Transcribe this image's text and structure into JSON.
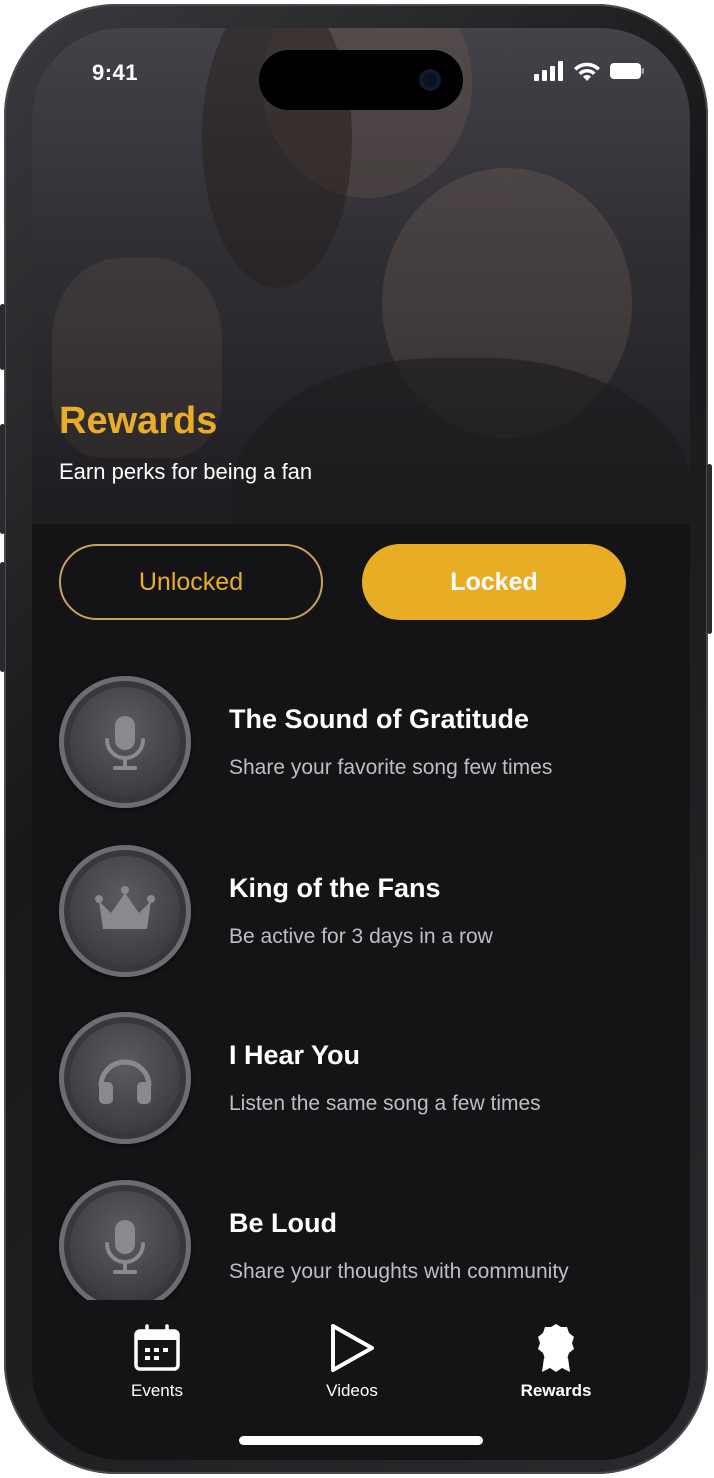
{
  "status_bar": {
    "time": "9:41"
  },
  "hero": {
    "title": "Rewards",
    "subtitle": "Earn perks for being a fan"
  },
  "toggle": {
    "options": [
      {
        "label": "Unlocked",
        "selected": false
      },
      {
        "label": "Locked",
        "selected": true
      }
    ]
  },
  "rewards": [
    {
      "title": "The Sound of Gratitude",
      "description": "Share your favorite song few times",
      "icon": "microphone-icon"
    },
    {
      "title": "King of the Fans",
      "description": "Be active for 3 days in a row",
      "icon": "crown-icon"
    },
    {
      "title": "I Hear You",
      "description": "Listen the same song a few times",
      "icon": "headphones-icon"
    },
    {
      "title": "Be Loud",
      "description": "Share your thoughts with community",
      "icon": "microphone-icon"
    }
  ],
  "nav": {
    "items": [
      {
        "label": "Events",
        "icon": "calendar-icon",
        "active": false
      },
      {
        "label": "Videos",
        "icon": "play-icon",
        "active": false
      },
      {
        "label": "Rewards",
        "icon": "award-badge-icon",
        "active": true
      }
    ]
  },
  "colors": {
    "accent": "#e9ac25",
    "background": "#141316",
    "badge": "#4a494d"
  }
}
